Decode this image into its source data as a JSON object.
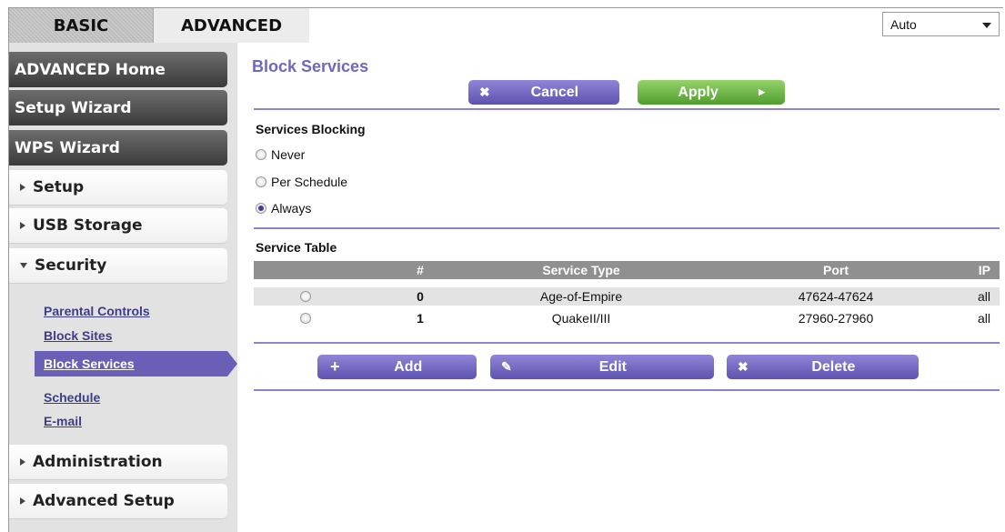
{
  "tabs": {
    "basic": "BASIC",
    "advanced": "ADVANCED"
  },
  "language": {
    "selected": "Auto"
  },
  "sidebar": {
    "advanced_home": "ADVANCED Home",
    "setup_wizard": "Setup Wizard",
    "wps_wizard": "WPS Wizard",
    "setup": "Setup",
    "usb_storage": "USB Storage",
    "security": "Security",
    "security_items": [
      "Parental Controls",
      "Block Sites",
      "Block Services",
      "Schedule",
      "E-mail"
    ],
    "administration": "Administration",
    "advanced_setup": "Advanced Setup"
  },
  "page": {
    "title": "Block Services",
    "cancel": "Cancel",
    "apply": "Apply"
  },
  "blocking": {
    "title": "Services Blocking",
    "options": [
      "Never",
      "Per Schedule",
      "Always"
    ],
    "selected": "Always"
  },
  "service_table": {
    "title": "Service Table",
    "headers": [
      "#",
      "Service Type",
      "Port",
      "IP"
    ],
    "rows": [
      [
        "0",
        "Age-of-Empire",
        "47624-47624",
        "all"
      ],
      [
        "1",
        "QuakeII/III",
        "27960-27960",
        "all"
      ]
    ]
  },
  "actions": {
    "add": "Add",
    "edit": "Edit",
    "delete": "Delete"
  },
  "colors": {
    "accent_purple": "#6e67c2",
    "apply_green": "#5fae3a",
    "sidebar_dark": "#4a4a4a"
  }
}
